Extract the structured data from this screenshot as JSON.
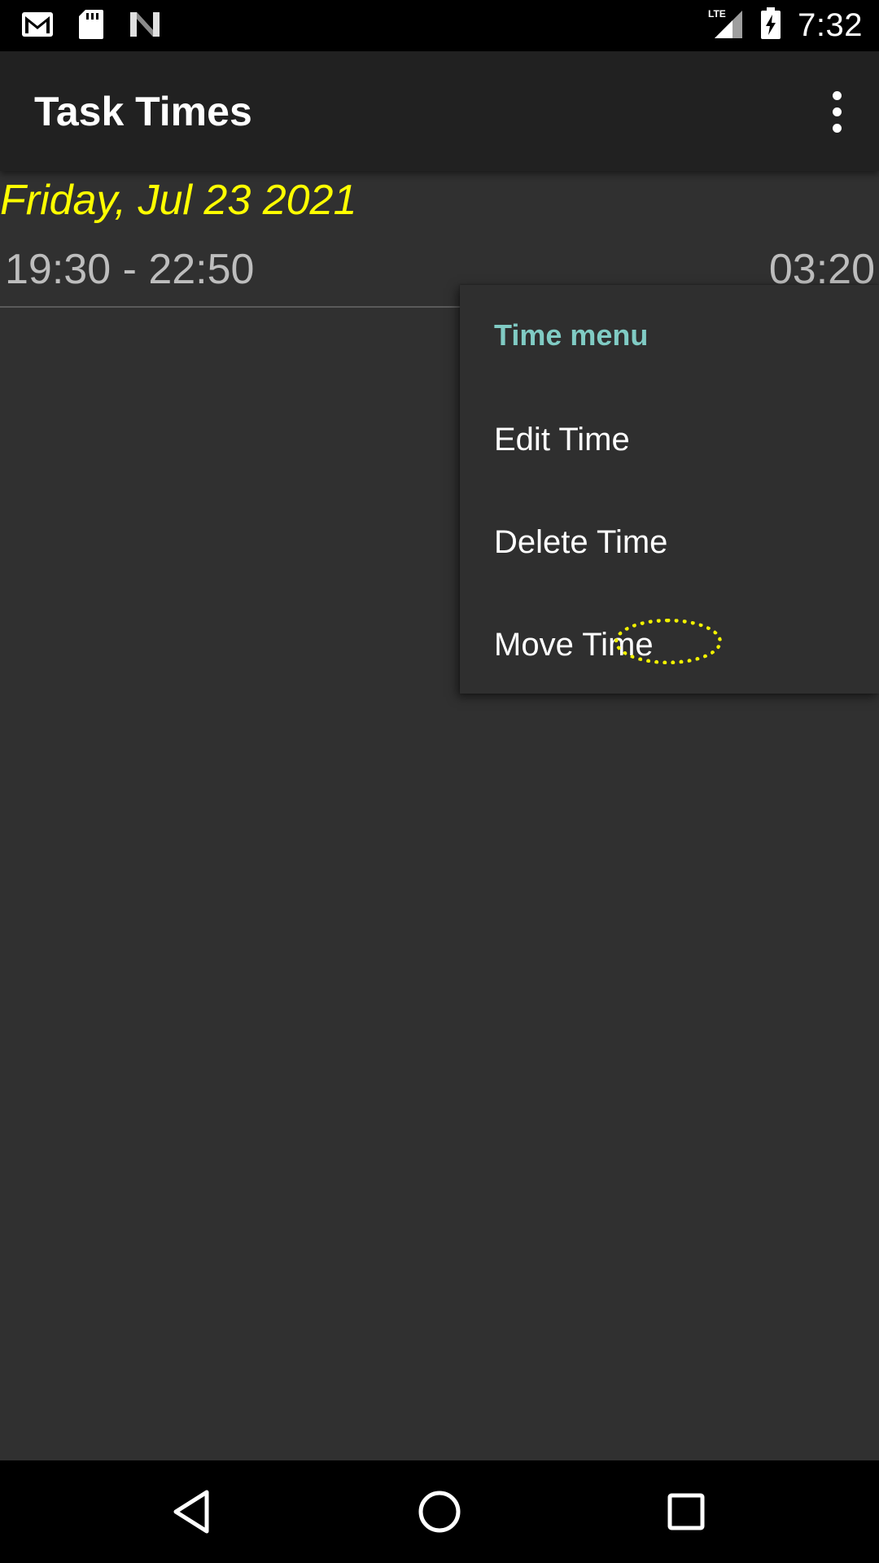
{
  "status_bar": {
    "time": "7:32",
    "left_icons": [
      "gmail-icon",
      "sd-card-icon",
      "n-logo-icon"
    ],
    "right_icons": [
      "lte-signal-icon",
      "battery-charging-icon"
    ]
  },
  "app_bar": {
    "title": "Task Times"
  },
  "content": {
    "date": "Friday, Jul 23 2021",
    "entry": {
      "range": "19:30 - 22:50",
      "duration": "03:20"
    }
  },
  "context_menu": {
    "title": "Time menu",
    "items": [
      {
        "label": "Edit Time"
      },
      {
        "label": "Delete Time"
      },
      {
        "label": "Move Time"
      }
    ]
  },
  "nav_bar": {
    "buttons": [
      "back-icon",
      "home-icon",
      "recents-icon"
    ]
  },
  "colors": {
    "date_heading": "#ffff00",
    "menu_title": "#80cbc4",
    "background": "#303030",
    "app_bar": "#212121"
  }
}
